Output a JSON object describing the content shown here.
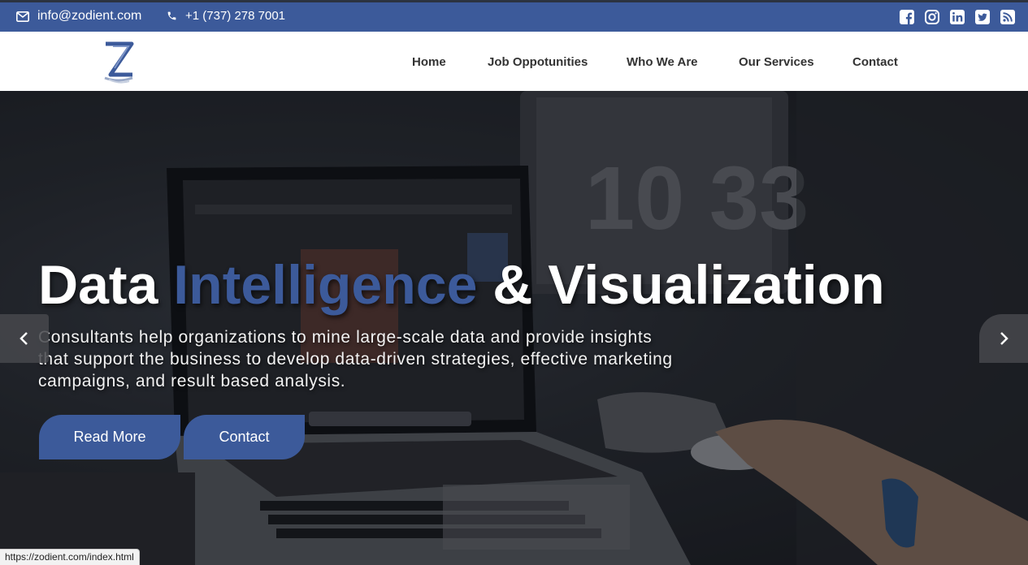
{
  "topbar": {
    "email": "info@zodient.com",
    "phone": "+1 (737) 278 7001",
    "socials": [
      "facebook-icon",
      "instagram-icon",
      "linkedin-icon",
      "twitter-icon",
      "rss-icon"
    ]
  },
  "nav": {
    "items": [
      {
        "label": "Home"
      },
      {
        "label": "Job Oppotunities"
      },
      {
        "label": "Who We Are"
      },
      {
        "label": "Our Services"
      },
      {
        "label": "Contact"
      }
    ]
  },
  "hero": {
    "headline_before": "Data ",
    "headline_accent": "Intelligence",
    "headline_after": " & Visualization",
    "subtext": "Consultants help organizations to mine large-scale data and provide insights that support the business to develop data-driven strategies, effective marketing campaigns, and result based analysis.",
    "read_more_label": "Read More",
    "contact_label": "Contact",
    "clock_text": "10 33"
  },
  "statusbar": {
    "url": "https://zodient.com/index.html"
  },
  "colors": {
    "brand": "#3c5a9a",
    "topbar_text": "#ffffff",
    "nav_text": "#333333"
  }
}
